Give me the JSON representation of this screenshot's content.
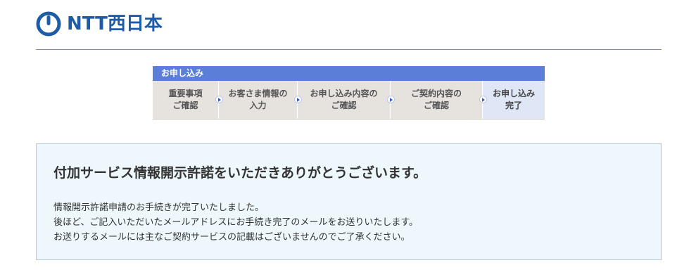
{
  "header": {
    "logo_text": "NTT西日本",
    "logo_icon": "ntt-mark-icon",
    "brand_color": "#1e5ca8"
  },
  "progress": {
    "title": "お申し込み",
    "steps": [
      {
        "label": "重要事項\nご確認",
        "active": false
      },
      {
        "label": "お客さま情報の\n入力",
        "active": false
      },
      {
        "label": "お申し込み内容の\nご確認",
        "active": false
      },
      {
        "label": "ご契約内容の\nご確認",
        "active": false
      },
      {
        "label": "お申し込み\n完了",
        "active": true
      }
    ],
    "header_color": "#5b7fd8",
    "active_color": "#dfe7f6"
  },
  "completion": {
    "title": "付加サービス情報開示許諾をいただきありがとうございます。",
    "lines": [
      "情報開示許諾申請のお手続きが完了いたしました。",
      "後ほど、ご記入いただいたメールアドレスにお手続き完了のメールをお送りいたします。",
      "お送りするメールには主なご契約サービスの記載はございませんのでご了承ください。"
    ],
    "background_color": "#eef8fc"
  }
}
